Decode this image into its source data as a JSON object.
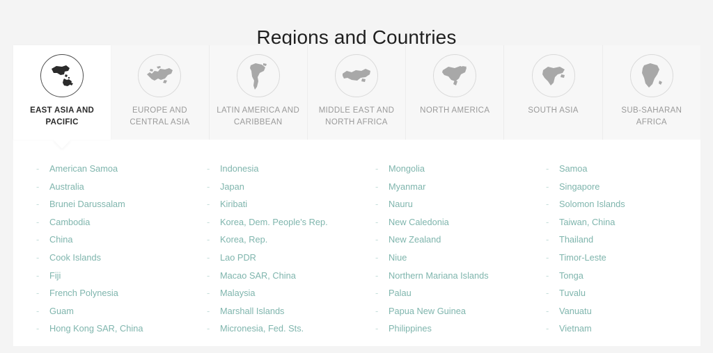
{
  "header": {
    "title": "Regions and Countries"
  },
  "tabs": [
    {
      "label": "EAST ASIA AND PACIFIC",
      "icon": "map-east-asia-pacific-icon",
      "active": true,
      "name": "tab-east-asia-and-pacific"
    },
    {
      "label": "EUROPE AND CENTRAL ASIA",
      "icon": "map-europe-central-asia-icon",
      "active": false,
      "name": "tab-europe-and-central-asia"
    },
    {
      "label": "LATIN AMERICA AND CARIBBEAN",
      "icon": "map-latin-america-caribbean-icon",
      "active": false,
      "name": "tab-latin-america-and-caribbean"
    },
    {
      "label": "MIDDLE EAST AND NORTH AFRICA",
      "icon": "map-middle-east-north-africa-icon",
      "active": false,
      "name": "tab-middle-east-and-north-africa"
    },
    {
      "label": "NORTH AMERICA",
      "icon": "map-north-america-icon",
      "active": false,
      "name": "tab-north-america"
    },
    {
      "label": "SOUTH ASIA",
      "icon": "map-south-asia-icon",
      "active": false,
      "name": "tab-south-asia"
    },
    {
      "label": "SUB-SAHARAN AFRICA",
      "icon": "map-sub-saharan-africa-icon",
      "active": false,
      "name": "tab-sub-saharan-africa"
    }
  ],
  "bullet": "-",
  "countries": {
    "col1": [
      "American Samoa",
      "Australia",
      "Brunei Darussalam",
      "Cambodia",
      "China",
      "Cook Islands",
      "Fiji",
      "French Polynesia",
      "Guam",
      "Hong Kong SAR, China"
    ],
    "col2": [
      "Indonesia",
      "Japan",
      "Kiribati",
      "Korea, Dem. People's Rep.",
      "Korea, Rep.",
      "Lao PDR",
      "Macao SAR, China",
      "Malaysia",
      "Marshall Islands",
      "Micronesia, Fed. Sts."
    ],
    "col3": [
      "Mongolia",
      "Myanmar",
      "Nauru",
      "New Caledonia",
      "New Zealand",
      "Niue",
      "Northern Mariana Islands",
      "Palau",
      "Papua New Guinea",
      "Philippines"
    ],
    "col4": [
      "Samoa",
      "Singapore",
      "Solomon Islands",
      "Taiwan, China",
      "Thailand",
      "Timor-Leste",
      "Tonga",
      "Tuvalu",
      "Vanuatu",
      "Vietnam"
    ]
  },
  "colors": {
    "page_background": "#f4f4f4",
    "panel_background": "#ffffff",
    "tabstrip_background": "#f7f7f7",
    "title_text": "#1f1f1f",
    "tab_label_inactive": "#9a9a9a",
    "tab_label_active": "#2b2b2b",
    "link_text": "#7fb5ad",
    "icon_inactive": "#a8a8a8",
    "icon_active": "#2b2b2b"
  }
}
